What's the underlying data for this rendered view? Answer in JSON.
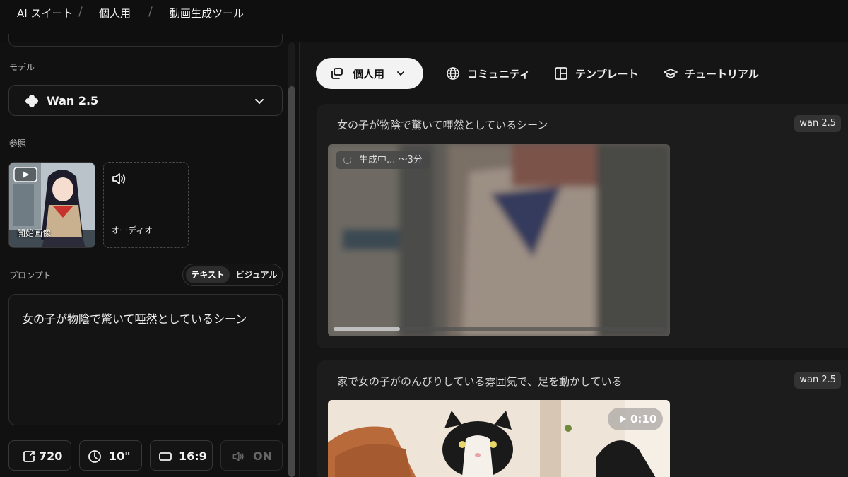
{
  "breadcrumb": [
    "AI スイート",
    "個人用",
    "動画生成ツール"
  ],
  "left": {
    "model_label": "モデル",
    "model_value": "Wan 2.5",
    "reference_label": "参照",
    "start_image_label": "開始画像",
    "audio_label": "オーディオ",
    "prompt_label": "プロンプト",
    "prompt_modes": [
      "テキスト",
      "ビジュアル"
    ],
    "prompt_text": "女の子が物陰で驚いて唖然としているシーン",
    "settings": {
      "resolution": "720",
      "duration": "10\"",
      "aspect": "16:9",
      "sound": "ON"
    }
  },
  "nav": {
    "personal": "個人用",
    "community": "コミュニティ",
    "templates": "テンプレート",
    "tutorial": "チュートリアル"
  },
  "cards": [
    {
      "title": "女の子が物陰で驚いて唖然としているシーン",
      "model_tag": "wan 2.5",
      "status": "生成中... 〜3分",
      "progress": 0.2
    },
    {
      "title": "家で女の子がのんびりしている雰囲気で、足を動かしている",
      "model_tag": "wan 2.5",
      "duration": "0:10"
    }
  ],
  "colors": {
    "background": "#111111",
    "panel": "#1c1c1c",
    "active_tab": "#f3f3f3"
  },
  "icons": [
    "layers-icon",
    "globe-icon",
    "template-grid-icon",
    "graduation-cap-icon",
    "flower-icon",
    "chevron-down-icon",
    "speaker-icon",
    "resize-icon",
    "clock-icon",
    "aspect-ratio-icon",
    "play-icon"
  ]
}
